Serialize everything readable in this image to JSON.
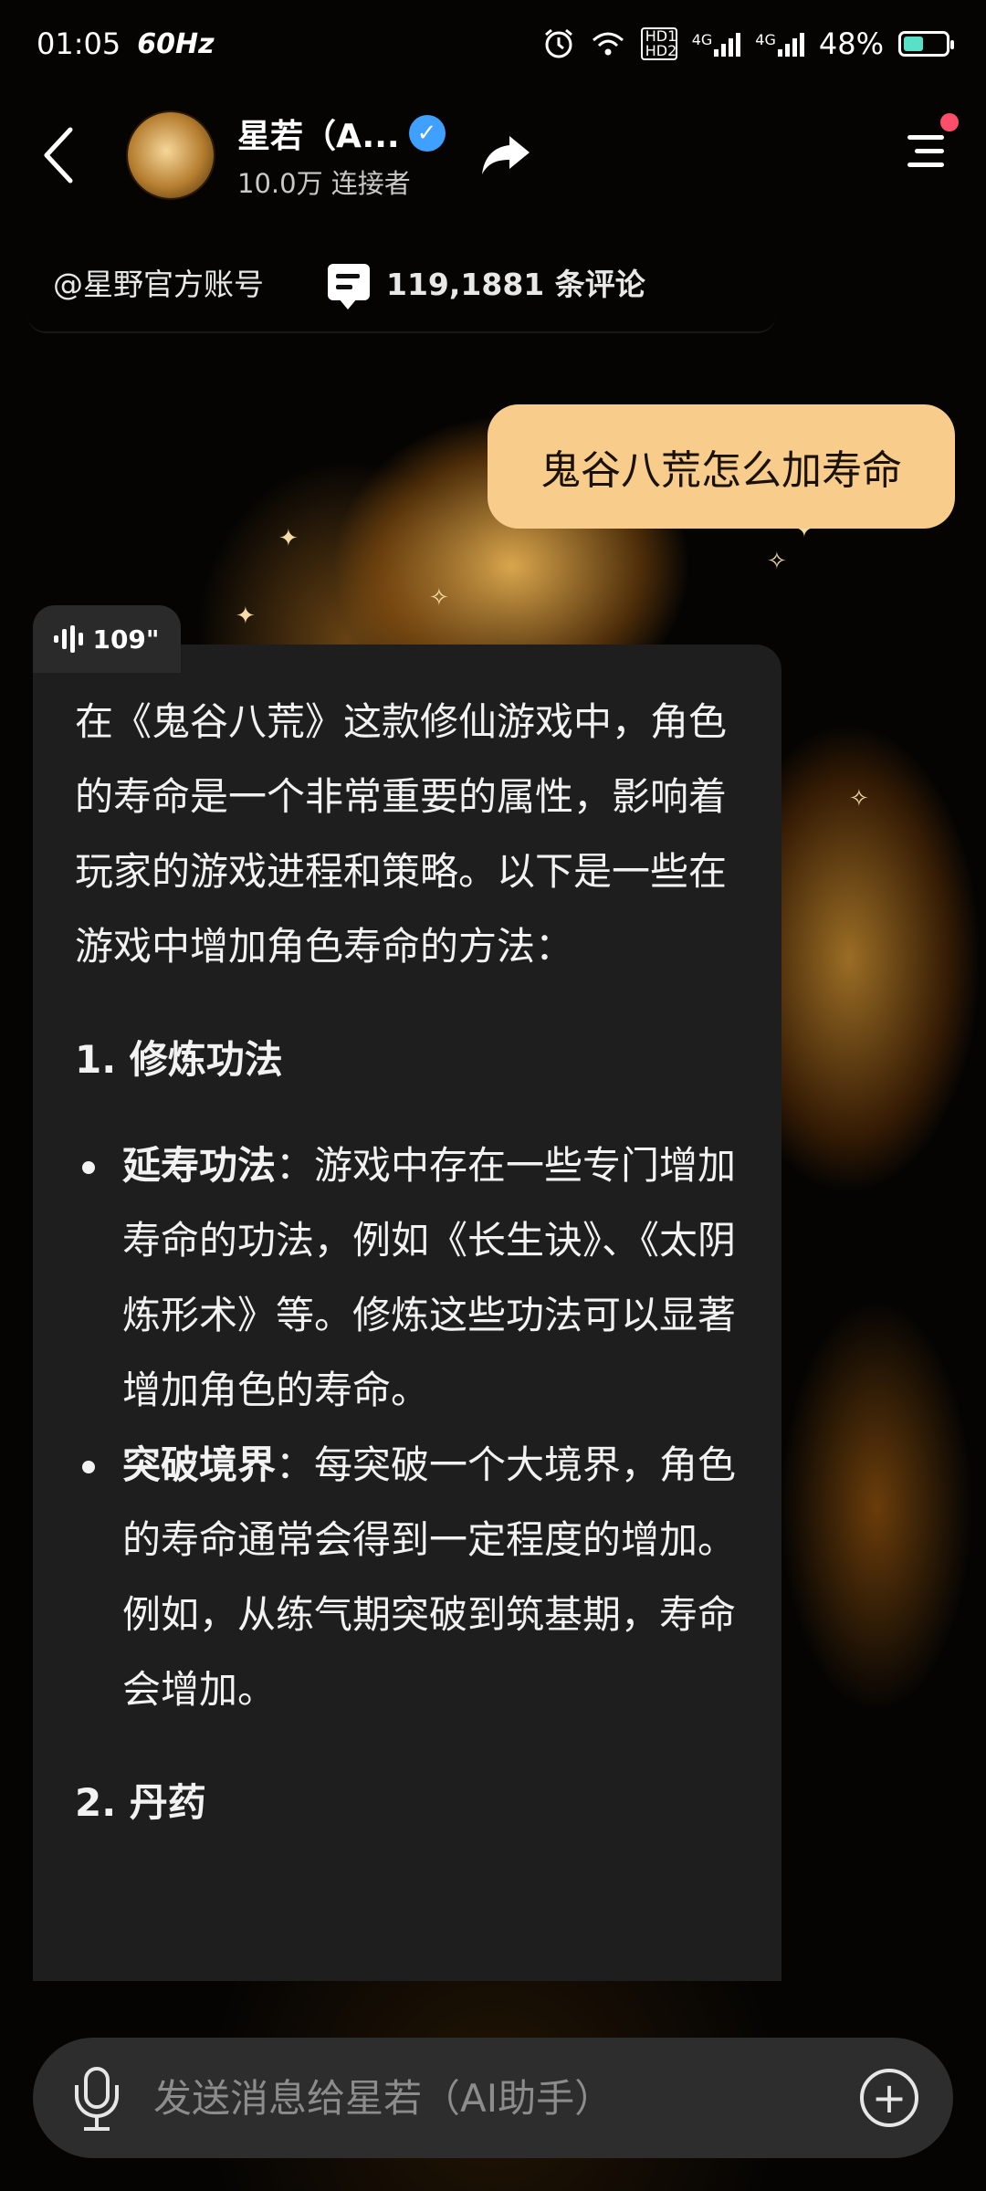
{
  "status_bar": {
    "time": "01:05",
    "refresh_rate": "60Hz",
    "hd_label": "HD1 HD2",
    "net_label_1": "4G",
    "net_label_2": "4G",
    "battery_percent": "48%",
    "battery_level": 0.48,
    "icons": [
      "alarm-icon",
      "hotspot-icon",
      "hd-icon",
      "signal-icon",
      "signal-icon",
      "battery-icon"
    ]
  },
  "header": {
    "name": "星若（A...",
    "subtitle": "10.0万 连接者",
    "verified": true,
    "has_notification_dot": true,
    "icons": [
      "back-arrow-icon",
      "verified-badge-icon",
      "share-arrow-icon",
      "menu-icon"
    ]
  },
  "infobar": {
    "account": "@星野官方账号",
    "comments": "119,1881 条评论",
    "comment_icon": "comment-bubble-icon"
  },
  "messages": {
    "user": "鬼谷八荒怎么加寿命",
    "ai": {
      "audio_duration": "109\"",
      "intro": "在《鬼谷八荒》这款修仙游戏中，角色的寿命是一个非常重要的属性，影响着玩家的游戏进程和策略。以下是一些在游戏中增加角色寿命的方法：",
      "section1_title": "1. 修炼功法",
      "items": [
        {
          "term": "延寿功法",
          "text": "：游戏中存在一些专门增加寿命的功法，例如《长生诀》、《太阴炼形术》等。修炼这些功法可以显著增加角色的寿命。"
        },
        {
          "term": "突破境界",
          "text": "：每突破一个大境界，角色的寿命通常会得到一定程度的增加。例如，从练气期突破到筑基期，寿命会增加。"
        }
      ],
      "section2_title": "2. 丹药"
    }
  },
  "input": {
    "placeholder": "发送消息给星若（AI助手）",
    "value": "",
    "icons": [
      "microphone-icon",
      "plus-circle-icon"
    ]
  },
  "colors": {
    "user_bubble": "#f8cd8c",
    "ai_bubble": "#1e1e1e",
    "input_bar": "#2d2d2d",
    "verified": "#3fa0ff",
    "notification_dot": "#ff4d6a",
    "battery_fill": "#59e0c8"
  }
}
